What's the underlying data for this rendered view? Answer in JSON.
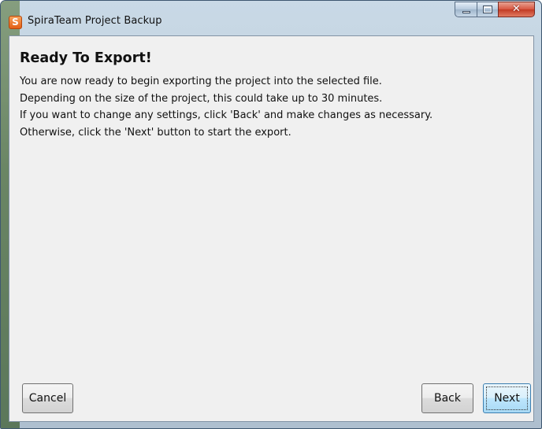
{
  "window": {
    "title": "SpiraTeam Project Backup",
    "app_icon_glyph": "S",
    "app_icon": "spirateam-logo-icon",
    "close_glyph": "✕"
  },
  "content": {
    "heading": "Ready To Export!",
    "lines": [
      "You are now ready to begin exporting the project into the selected file.",
      "Depending on the size of the project, this could take up to 30 minutes.",
      "If you want to change any settings, click 'Back' and make changes as necessary.",
      "Otherwise, click the 'Next' button to start the export."
    ]
  },
  "buttons": {
    "cancel": "Cancel",
    "back": "Back",
    "next": "Next"
  },
  "colors": {
    "client_bg": "#f0f0f0",
    "focused_button_border": "#3c7fb1",
    "app_icon_orange": "#e35f15"
  }
}
